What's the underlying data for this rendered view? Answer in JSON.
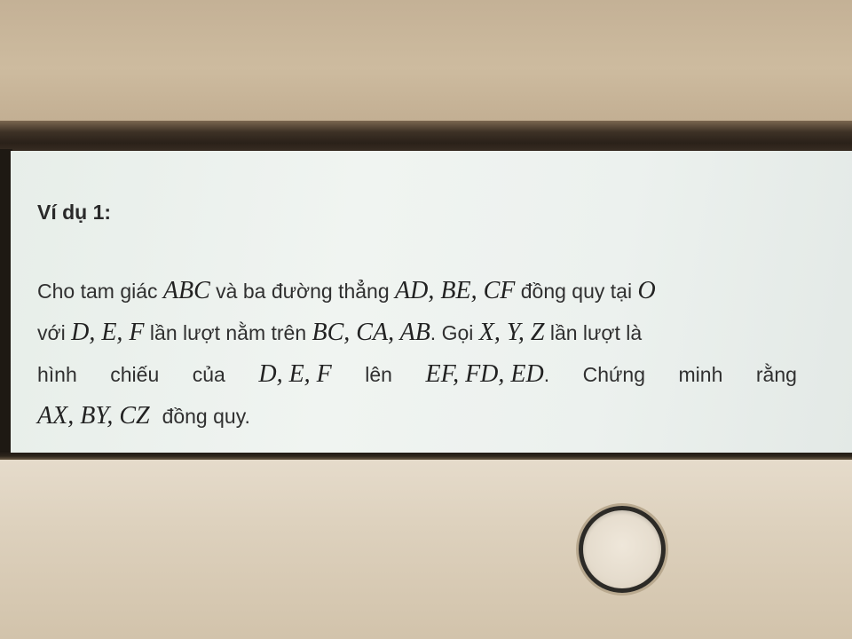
{
  "example": {
    "title": "Ví dụ 1:"
  },
  "problem": {
    "lines": [
      [
        {
          "t": "Cho tam giác "
        },
        {
          "m": "ABC"
        },
        {
          "t": " và ba đường thẳng "
        },
        {
          "m": "AD, BE, CF"
        },
        {
          "t": " đồng quy tại "
        },
        {
          "m": "O"
        }
      ],
      [
        {
          "t": "với "
        },
        {
          "m": "D, E, F"
        },
        {
          "t": " lần lượt nằm trên "
        },
        {
          "m": "BC, CA, AB"
        },
        {
          "t": ". Gọi "
        },
        {
          "m": "X, Y, Z"
        },
        {
          "t": " lần lượt là"
        }
      ],
      [
        {
          "t": "hình"
        },
        {
          "t": "chiếu"
        },
        {
          "t": "của"
        },
        {
          "m": "D, E, F"
        },
        {
          "t": "lên"
        },
        {
          "m": "EF, FD, ED"
        },
        {
          "t": "."
        },
        {
          "t": "Chứng"
        },
        {
          "t": "minh"
        },
        {
          "t": "rằng"
        }
      ],
      [
        {
          "m": "AX, BY, CZ"
        },
        {
          "t": "đồng quy."
        }
      ]
    ]
  },
  "device": {
    "home_button_icon": "home-button-ring"
  }
}
